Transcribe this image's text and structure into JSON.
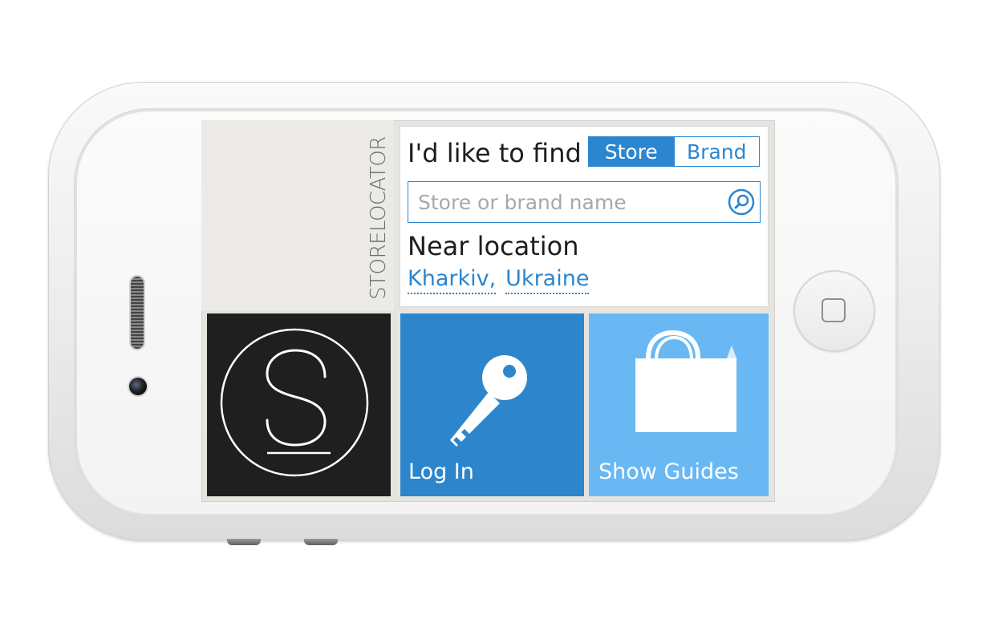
{
  "app": {
    "brand_vertical": "STORELOCATOR"
  },
  "find": {
    "label": "I'd like to find",
    "toggle": {
      "options": [
        "Store",
        "Brand"
      ],
      "selected": "Store"
    }
  },
  "search": {
    "placeholder": "Store or brand name",
    "value": "",
    "icon": "search-icon"
  },
  "near": {
    "label": "Near location",
    "city": "Kharkiv,",
    "country": "Ukraine"
  },
  "tiles": {
    "logo": {
      "icon": "store-logo-icon",
      "color": "#1f1f1f"
    },
    "login": {
      "label": "Log In",
      "icon": "key-icon",
      "color": "#2d86cc"
    },
    "guides": {
      "label": "Show Guides",
      "icon": "shopping-bag-icon",
      "color": "#6ab8f3"
    }
  },
  "theme": {
    "accent": "#2b86cf"
  }
}
